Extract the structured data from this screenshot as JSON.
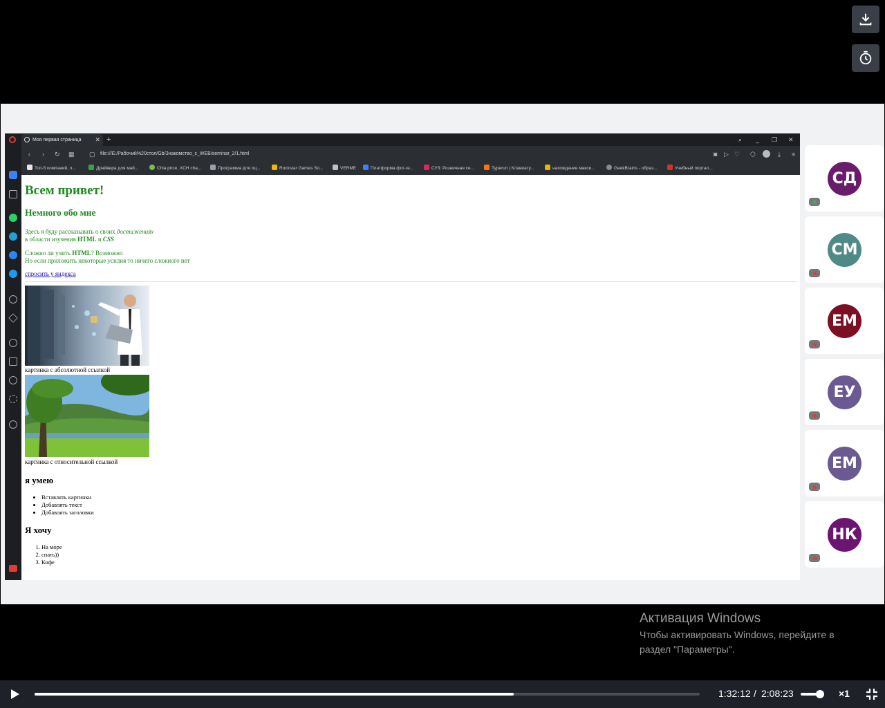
{
  "browser": {
    "tab_title": "Моя первая страница",
    "url": "file:///E:/Рабочий%20стол/Gb/Знакомство_с_WEB/seminar_2/1.html",
    "bookmarks": [
      {
        "label": "Топ-5 компаний, п...",
        "color": "#e6e6e6"
      },
      {
        "label": "Драйвера для май...",
        "color": "#3aa04a"
      },
      {
        "label": "Chia price, XCH cha...",
        "color": "#7bc043"
      },
      {
        "label": "Программа для оц...",
        "color": "#9aa0a8"
      },
      {
        "label": "Rockstar Games So...",
        "color": "#f4b400"
      },
      {
        "label": "VERME",
        "color": "#c0c0c0"
      },
      {
        "label": "Платформа фог-ге...",
        "color": "#3b82f6"
      },
      {
        "label": "СУЗ: Розничная се...",
        "color": "#e0245e"
      },
      {
        "label": "Typerun | Клавиату...",
        "color": "#f97316"
      },
      {
        "label": "нахождение макси...",
        "color": "#eab308"
      },
      {
        "label": "GeekBrains - образ...",
        "color": "#8b8b8b"
      },
      {
        "label": "Учебный портал...",
        "color": "#d93025"
      }
    ]
  },
  "page": {
    "h1": "Всем привет!",
    "h2": "Немного обо мне",
    "para1_line1_prefix": "Здесь я буду рассказывать о своих ",
    "para1_line1_em": "достижениях",
    "para1_line2_prefix": "в области изучения ",
    "para1_html": "HTML",
    "para1_and": " и ",
    "para1_css": "CSS",
    "para2_line1_prefix": "Сложно ли учить ",
    "para2_html": "HTML",
    "para2_line1_suffix": "? Возможно",
    "para2_line2": "Но если приложить некоторые усилия то ничего сложного нет",
    "link": "спросить у яндекса",
    "caption1": "картинка с абсолютной ссылкой",
    "caption2": "картинка с относительной ссылкой",
    "h3_can": "я умею",
    "can_list": [
      "Вставлять картинки",
      "Добавлять текст",
      "Добавлять заголовки"
    ],
    "h3_want": "Я хочу",
    "want_list": [
      "На море",
      "спать))",
      "Кофе"
    ]
  },
  "participants": [
    {
      "initials": "СД",
      "color": "#6a1b6a",
      "mic": "#3ab54a"
    },
    {
      "initials": "СМ",
      "color": "#4f8a86",
      "mic": "#e53935"
    },
    {
      "initials": "ЕМ",
      "color": "#7a1022",
      "mic": "#e53935"
    },
    {
      "initials": "ЕУ",
      "color": "#6b5a92",
      "mic": "#e53935"
    },
    {
      "initials": "ЕМ",
      "color": "#6b5a92",
      "mic": "#e53935"
    },
    {
      "initials": "НК",
      "color": "#6b1470",
      "mic": "#e53935"
    }
  ],
  "activation": {
    "title": "Активация Windows",
    "subtitle": "Чтобы активировать Windows, перейдите в раздел \"Параметры\"."
  },
  "player": {
    "current_time": "1:32:12",
    "separator": "/",
    "total_time": "2:08:23",
    "speed": "×1",
    "progress": 0.72
  }
}
